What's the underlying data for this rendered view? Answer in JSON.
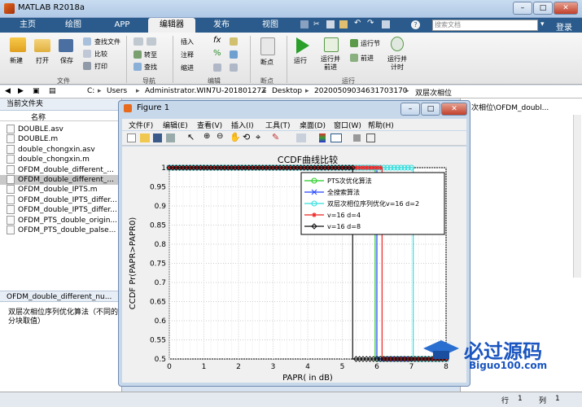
{
  "app": {
    "title": "MATLAB R2018a"
  },
  "tabs": [
    "主页",
    "绘图",
    "APP",
    "编辑器",
    "发布",
    "视图"
  ],
  "search": {
    "placeholder": "搜索文档"
  },
  "login_label": "登录",
  "ribbon": {
    "file_group": {
      "new": "新建",
      "open": "打开",
      "save": "保存",
      "find_files": "查找文件",
      "compare": "比较",
      "print": "打印",
      "label": "文件"
    },
    "nav_group": {
      "goto": "转至",
      "find": "查找",
      "label": "导航"
    },
    "edit_group": {
      "insert": "插入",
      "comment": "注释",
      "indent": "缩进",
      "label": "编辑"
    },
    "breakpoint_group": {
      "breakpoint": "断点",
      "label": "断点"
    },
    "run_group": {
      "run": "运行",
      "run_advance": "运行并\n前进",
      "run_section": "运行节",
      "advance": "前进",
      "run_time": "运行并\n计时",
      "label": "运行"
    }
  },
  "address": {
    "path": [
      "C:",
      "Users",
      "Administrator.WIN7U-20180127Z",
      "Desktop",
      "20200509034631703170",
      "双层次相位"
    ]
  },
  "current_folder": {
    "header": "当前文件夹",
    "name_col": "名称",
    "files": [
      "DOUBLE.asv",
      "DOUBLE.m",
      "double_chongxin.asv",
      "double_chongxin.m",
      "OFDM_double_different_...",
      "OFDM_double_different_...",
      "OFDM_double_IPTS.m",
      "OFDM_double_IPTS_differ...",
      "OFDM_double_IPTS_differ...",
      "OFDM_PTS_double_origin...",
      "OFDM_PTS_double_palse..."
    ],
    "selected_index": 5
  },
  "details": {
    "filename": "OFDM_double_different_nu...",
    "description": "双层次相位序列优化算法（不同的\n分块取值）"
  },
  "editor_tab_right": "次相位\\OFDM_doubl...",
  "figure": {
    "title": "Figure 1",
    "menu": [
      "文件(F)",
      "编辑(E)",
      "查看(V)",
      "插入(I)",
      "工具(T)",
      "桌面(D)",
      "窗口(W)",
      "帮助(H)"
    ]
  },
  "chart_data": {
    "type": "line",
    "title": "CCDF曲线比较",
    "xlabel": "PAPR( in dB)",
    "ylabel": "CCDF Pr(PAPR>PAPR0)",
    "xlim": [
      0,
      8
    ],
    "ylim": [
      0.5,
      1
    ],
    "xticks": [
      0,
      1,
      2,
      3,
      4,
      5,
      6,
      7,
      8
    ],
    "yticks": [
      0.5,
      0.55,
      0.6,
      0.65,
      0.7,
      0.75,
      0.8,
      0.85,
      0.9,
      0.95,
      1
    ],
    "grid": true,
    "legend_position": "top-right",
    "series": [
      {
        "name": "PTS次优化算法",
        "color": "#22cc22",
        "marker": "circle",
        "step_x": 5.95
      },
      {
        "name": "全搜索算法",
        "color": "#2244ff",
        "marker": "x",
        "step_x": 6.0
      },
      {
        "name": "双层次相位序列优化v=16 d=2",
        "color": "#33dddd",
        "marker": "circle",
        "step_x": 7.05
      },
      {
        "name": "v=16 d=4",
        "color": "#ee2222",
        "marker": "star",
        "step_x": 6.15
      },
      {
        "name": "v=16 d=8",
        "color": "#111111",
        "marker": "diamond",
        "step_x": 5.3
      }
    ]
  },
  "status": {
    "row_label": "行",
    "row": "1",
    "col_label": "列",
    "col": "1"
  },
  "watermark": {
    "text": "必过源码",
    "sub": "Biguo100.com"
  }
}
